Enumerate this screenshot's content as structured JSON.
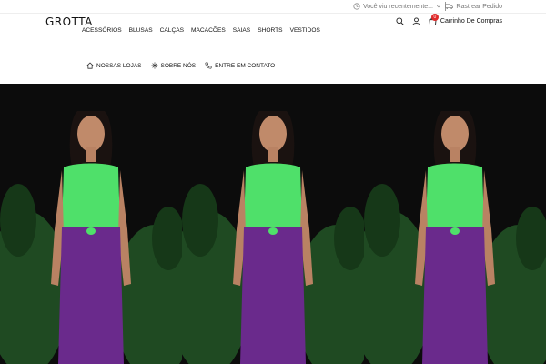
{
  "topbar": {
    "recent_label": "Você viu recentemente...",
    "track_label": "Rastrear Pedido"
  },
  "header": {
    "logo": "GROTTA",
    "nav": [
      "ACESSÓRIOS",
      "BLUSAS",
      "CALÇAS",
      "MACACÕES",
      "SAIAS",
      "SHORTS",
      "VESTIDOS"
    ],
    "cart_label": "Carrinho De Compras",
    "cart_count": "0"
  },
  "subnav": {
    "items": [
      "NOSSAS LOJAS",
      "SOBRE NÓS",
      "ENTRE EM CONTATO"
    ]
  },
  "hero": {
    "top_color": "#4fe06a",
    "skirt_color": "#6a2a8c",
    "background_color": "#0c0c0c",
    "foliage_color": "#1f4a22"
  }
}
